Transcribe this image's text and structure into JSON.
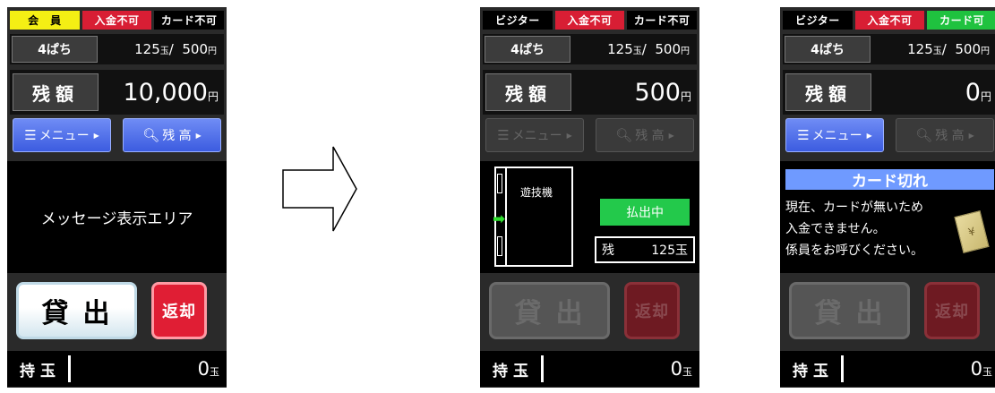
{
  "screens": [
    {
      "status": [
        {
          "label": "会　員",
          "bg": "#f4ef14",
          "fg": "#000000"
        },
        {
          "label": "入金不可",
          "bg": "#d81e34",
          "fg": "#ffffff"
        },
        {
          "label": "カード不可",
          "bg": "#000000",
          "fg": "#ffffff"
        }
      ],
      "rate_label": "4ぱち",
      "rate_balls": "125",
      "rate_ball_unit": "玉",
      "rate_sep": "/",
      "rate_yen": "500",
      "rate_yen_unit": "円",
      "balance_label": "残額",
      "balance_value": "10,000",
      "balance_unit": "円",
      "menu_label": "メニュー",
      "menu_enabled": true,
      "balance_btn_label": "残 高",
      "balance_btn_enabled": true,
      "message": "メッセージ表示エリア",
      "lend_label": "貸出",
      "lend_enabled": true,
      "return_label": "返却",
      "return_enabled": true,
      "hold_label": "持玉",
      "hold_value": "0",
      "hold_unit": "玉"
    },
    {
      "status": [
        {
          "label": "ビジター",
          "bg": "#000000",
          "fg": "#ffffff"
        },
        {
          "label": "入金不可",
          "bg": "#d81e34",
          "fg": "#ffffff"
        },
        {
          "label": "カード不可",
          "bg": "#000000",
          "fg": "#ffffff"
        }
      ],
      "rate_label": "4ぱち",
      "rate_balls": "125",
      "rate_ball_unit": "玉",
      "rate_sep": "/",
      "rate_yen": "500",
      "rate_yen_unit": "円",
      "balance_label": "残額",
      "balance_value": "500",
      "balance_unit": "円",
      "menu_label": "メニュー",
      "menu_enabled": false,
      "balance_btn_label": "残 高",
      "balance_btn_enabled": false,
      "machine_label": "遊技機",
      "payout_label": "払出中",
      "remain_label": "残",
      "remain_value": "125玉",
      "lend_label": "貸出",
      "lend_enabled": false,
      "return_label": "返却",
      "return_enabled": false,
      "hold_label": "持玉",
      "hold_value": "0",
      "hold_unit": "玉"
    },
    {
      "status": [
        {
          "label": "ビジター",
          "bg": "#000000",
          "fg": "#ffffff"
        },
        {
          "label": "入金不可",
          "bg": "#d81e34",
          "fg": "#ffffff"
        },
        {
          "label": "カード可",
          "bg": "#1fc23f",
          "fg": "#ffffff"
        }
      ],
      "rate_label": "4ぱち",
      "rate_balls": "125",
      "rate_ball_unit": "玉",
      "rate_sep": "/",
      "rate_yen": "500",
      "rate_yen_unit": "円",
      "balance_label": "残額",
      "balance_value": "0",
      "balance_unit": "円",
      "menu_label": "メニュー",
      "menu_enabled": true,
      "balance_btn_label": "残 高",
      "balance_btn_enabled": false,
      "card_out_title": "カード切れ",
      "card_out_lines": [
        "現在、カードが無いため",
        "入金できません。",
        "係員をお呼びください。"
      ],
      "card_icon_glyph": "¥",
      "lend_label": "貸出",
      "lend_enabled": false,
      "return_label": "返却",
      "return_enabled": false,
      "hold_label": "持玉",
      "hold_value": "0",
      "hold_unit": "玉"
    }
  ],
  "icons": {
    "menu": "hamburger-icon",
    "balance": "magnifier-icon",
    "flow": "right-arrow-icon",
    "card": "yen-card-icon"
  }
}
